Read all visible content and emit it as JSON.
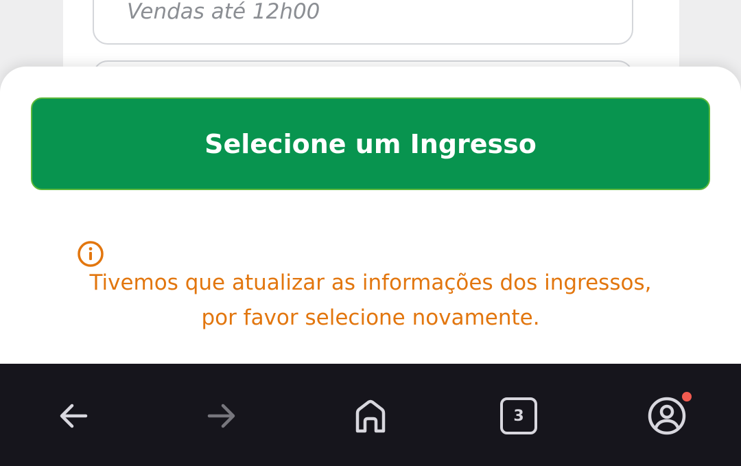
{
  "background": {
    "sales_until": "Vendas até 12h00"
  },
  "sheet": {
    "cta_label": "Selecione um Ingresso",
    "info_icon": "info-circle-icon",
    "notice_line1": "Tivemos que atualizar as informações dos ingressos,",
    "notice_line2": "por favor selecione novamente."
  },
  "navbar": {
    "back_icon": "arrow-left-icon",
    "forward_icon": "arrow-right-icon",
    "home_icon": "home-icon",
    "tabs_count": "3",
    "profile_icon": "user-circle-icon"
  },
  "colors": {
    "cta_green": "#08944f",
    "notice_orange": "#e2760e",
    "navbar_bg": "#16151c",
    "badge_red": "#f25b50"
  }
}
